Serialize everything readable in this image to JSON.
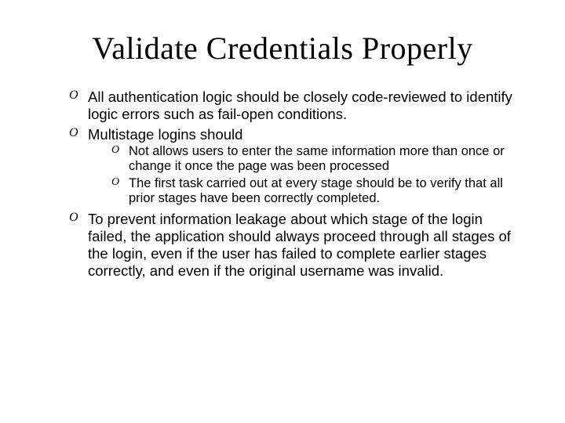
{
  "title": "Validate Credentials Properly",
  "bullets": {
    "b1": "All authentication logic should be closely code-reviewed to identify logic errors such as fail-open conditions.",
    "b2": "Multistage logins should",
    "b2_sub": {
      "s1": "Not allows users to enter the same information more than once or change it once the page was been processed",
      "s2": "The first task carried out at every stage should be to verify that all prior stages have been correctly completed."
    },
    "b3": "To prevent information leakage about which stage of the login failed, the application should always proceed through all stages of the login, even if the user has failed to complete earlier stages correctly, and even if the original username was invalid."
  }
}
